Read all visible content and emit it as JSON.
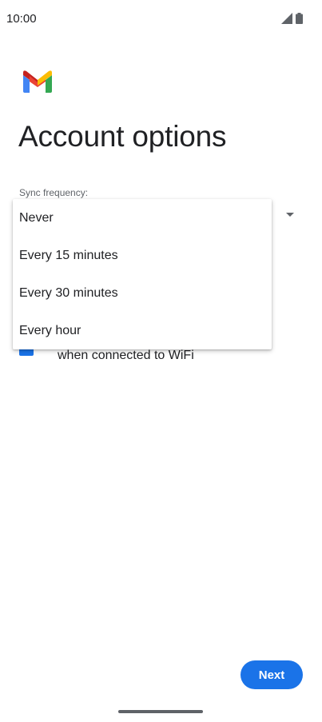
{
  "status_bar": {
    "time": "10:00",
    "icons": [
      "signal-icon",
      "battery-icon"
    ]
  },
  "app": {
    "logo": "gmail-logo-icon",
    "colors": {
      "red": "#EA4335",
      "blue": "#4285F4",
      "green": "#34A853",
      "yellow": "#FBBC04",
      "dark_red": "#C5221F"
    }
  },
  "page": {
    "title": "Account options"
  },
  "sync": {
    "label": "Sync frequency:",
    "options": [
      "Never",
      "Every 15 minutes",
      "Every 30 minutes",
      "Every hour"
    ]
  },
  "wifi_checkbox": {
    "label": "when connected to WiFi",
    "checked": true
  },
  "footer": {
    "next_label": "Next"
  },
  "theme": {
    "accent": "#1a73e8"
  }
}
